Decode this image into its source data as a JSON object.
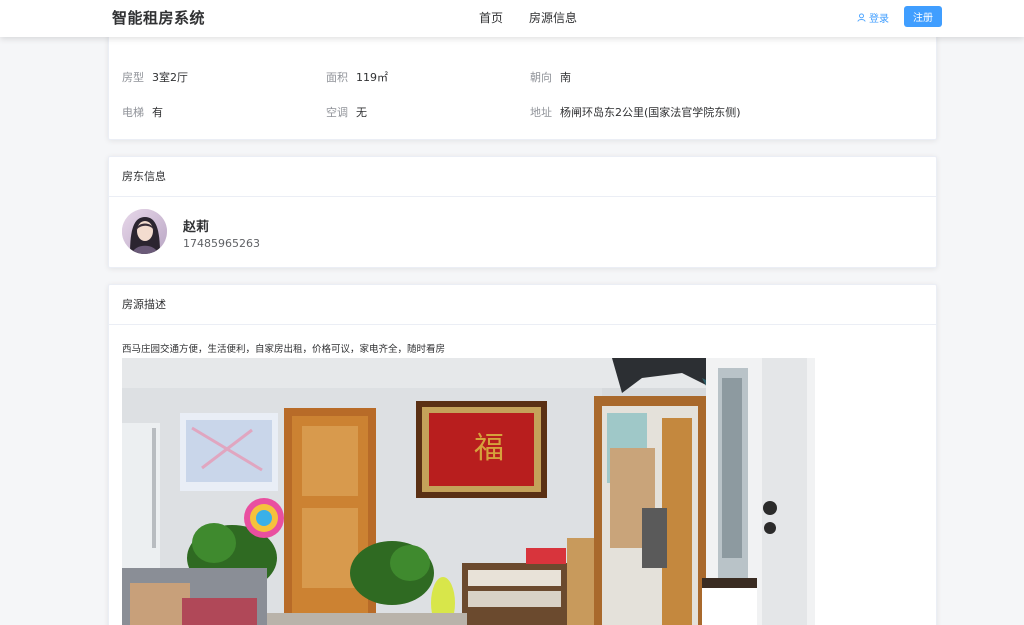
{
  "header": {
    "brand": "智能租房系统",
    "nav": [
      {
        "label": "首页"
      },
      {
        "label": "房源信息"
      }
    ],
    "login_label": "登录",
    "register_label": "注册"
  },
  "attributes": [
    {
      "key": "房型",
      "value": "3室2厅"
    },
    {
      "key": "面积",
      "value": "119㎡"
    },
    {
      "key": "朝向",
      "value": "南"
    },
    {
      "key": "电梯",
      "value": "有"
    },
    {
      "key": "空调",
      "value": "无"
    },
    {
      "key": "地址",
      "value": "杨闸环岛东2公里(国家法官学院东侧)"
    }
  ],
  "landlord": {
    "title": "房东信息",
    "name": "赵莉",
    "phone": "17485965263"
  },
  "description": {
    "title": "房源描述",
    "text": "西马庄园交通方便，生活便利，自家房出租，价格可议，家电齐全，随时看房"
  },
  "colors": {
    "primary": "#409eff",
    "text": "#303133",
    "muted": "#909399"
  }
}
